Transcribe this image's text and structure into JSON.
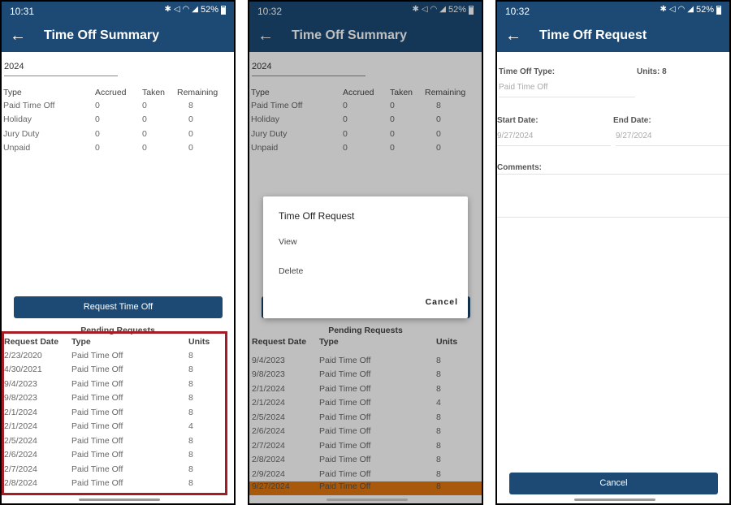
{
  "screens": [
    {
      "status": {
        "time": "10:31",
        "battery": "52%"
      },
      "title": "Time Off Summary",
      "year": "2024",
      "summary": {
        "headers": [
          "Type",
          "Accrued",
          "Taken",
          "Remaining"
        ],
        "rows": [
          {
            "type": "Paid Time Off",
            "accrued": "0",
            "taken": "0",
            "remaining": "8"
          },
          {
            "type": "Holiday",
            "accrued": "0",
            "taken": "0",
            "remaining": "0"
          },
          {
            "type": "Jury Duty",
            "accrued": "0",
            "taken": "0",
            "remaining": "0"
          },
          {
            "type": "Unpaid",
            "accrued": "0",
            "taken": "0",
            "remaining": "0"
          }
        ]
      },
      "request_button": "Request Time Off",
      "pending": {
        "title": "Pending Requests",
        "headers": [
          "Request Date",
          "Type",
          "Units"
        ],
        "rows": [
          {
            "date": "2/23/2020",
            "type": "Paid Time Off",
            "units": "8"
          },
          {
            "date": "4/30/2021",
            "type": "Paid Time Off",
            "units": "8"
          },
          {
            "date": "9/4/2023",
            "type": "Paid Time Off",
            "units": "8"
          },
          {
            "date": "9/8/2023",
            "type": "Paid Time Off",
            "units": "8"
          },
          {
            "date": "2/1/2024",
            "type": "Paid Time Off",
            "units": "8"
          },
          {
            "date": "2/1/2024",
            "type": "Paid Time Off",
            "units": "4"
          },
          {
            "date": "2/5/2024",
            "type": "Paid Time Off",
            "units": "8"
          },
          {
            "date": "2/6/2024",
            "type": "Paid Time Off",
            "units": "8"
          },
          {
            "date": "2/7/2024",
            "type": "Paid Time Off",
            "units": "8"
          },
          {
            "date": "2/8/2024",
            "type": "Paid Time Off",
            "units": "8"
          }
        ]
      }
    },
    {
      "status": {
        "time": "10:32",
        "battery": "52%"
      },
      "title": "Time Off Summary",
      "year": "2024",
      "summary": {
        "headers": [
          "Type",
          "Accrued",
          "Taken",
          "Remaining"
        ],
        "rows": [
          {
            "type": "Paid Time Off",
            "accrued": "0",
            "taken": "0",
            "remaining": "8"
          },
          {
            "type": "Holiday",
            "accrued": "0",
            "taken": "0",
            "remaining": "0"
          },
          {
            "type": "Jury Duty",
            "accrued": "0",
            "taken": "0",
            "remaining": "0"
          },
          {
            "type": "Unpaid",
            "accrued": "0",
            "taken": "0",
            "remaining": "0"
          }
        ]
      },
      "pending": {
        "title": "Pending Requests",
        "headers": [
          "Request Date",
          "Type",
          "Units"
        ],
        "rows": [
          {
            "date": "9/4/2023",
            "type": "Paid Time Off",
            "units": "8"
          },
          {
            "date": "9/8/2023",
            "type": "Paid Time Off",
            "units": "8"
          },
          {
            "date": "2/1/2024",
            "type": "Paid Time Off",
            "units": "8"
          },
          {
            "date": "2/1/2024",
            "type": "Paid Time Off",
            "units": "4"
          },
          {
            "date": "2/5/2024",
            "type": "Paid Time Off",
            "units": "8"
          },
          {
            "date": "2/6/2024",
            "type": "Paid Time Off",
            "units": "8"
          },
          {
            "date": "2/7/2024",
            "type": "Paid Time Off",
            "units": "8"
          },
          {
            "date": "2/8/2024",
            "type": "Paid Time Off",
            "units": "8"
          },
          {
            "date": "2/9/2024",
            "type": "Paid Time Off",
            "units": "8"
          },
          {
            "date": "9/27/2024",
            "type": "Paid Time Off",
            "units": "8"
          }
        ],
        "selected_row": 9
      },
      "dialog": {
        "title": "Time Off Request",
        "view": "View",
        "delete": "Delete",
        "cancel": "Cancel"
      }
    },
    {
      "status": {
        "time": "10:32",
        "battery": "52%"
      },
      "title": "Time Off Request",
      "form": {
        "type_label": "Time Off Type:",
        "type_value": "Paid Time Off",
        "units_label": "Units: 8",
        "start_label": "Start Date:",
        "start_value": "9/27/2024",
        "end_label": "End Date:",
        "end_value": "9/27/2024",
        "comments_label": "Comments:"
      },
      "cancel_button": "Cancel"
    }
  ],
  "colors": {
    "app_bar": "#1d4a75",
    "highlight_row": "#e0770f",
    "callout_border": "#a51d24"
  },
  "icons": [
    "back-arrow-icon",
    "bluetooth-icon",
    "mute-icon",
    "wifi-icon",
    "signal-icon",
    "battery-icon"
  ]
}
